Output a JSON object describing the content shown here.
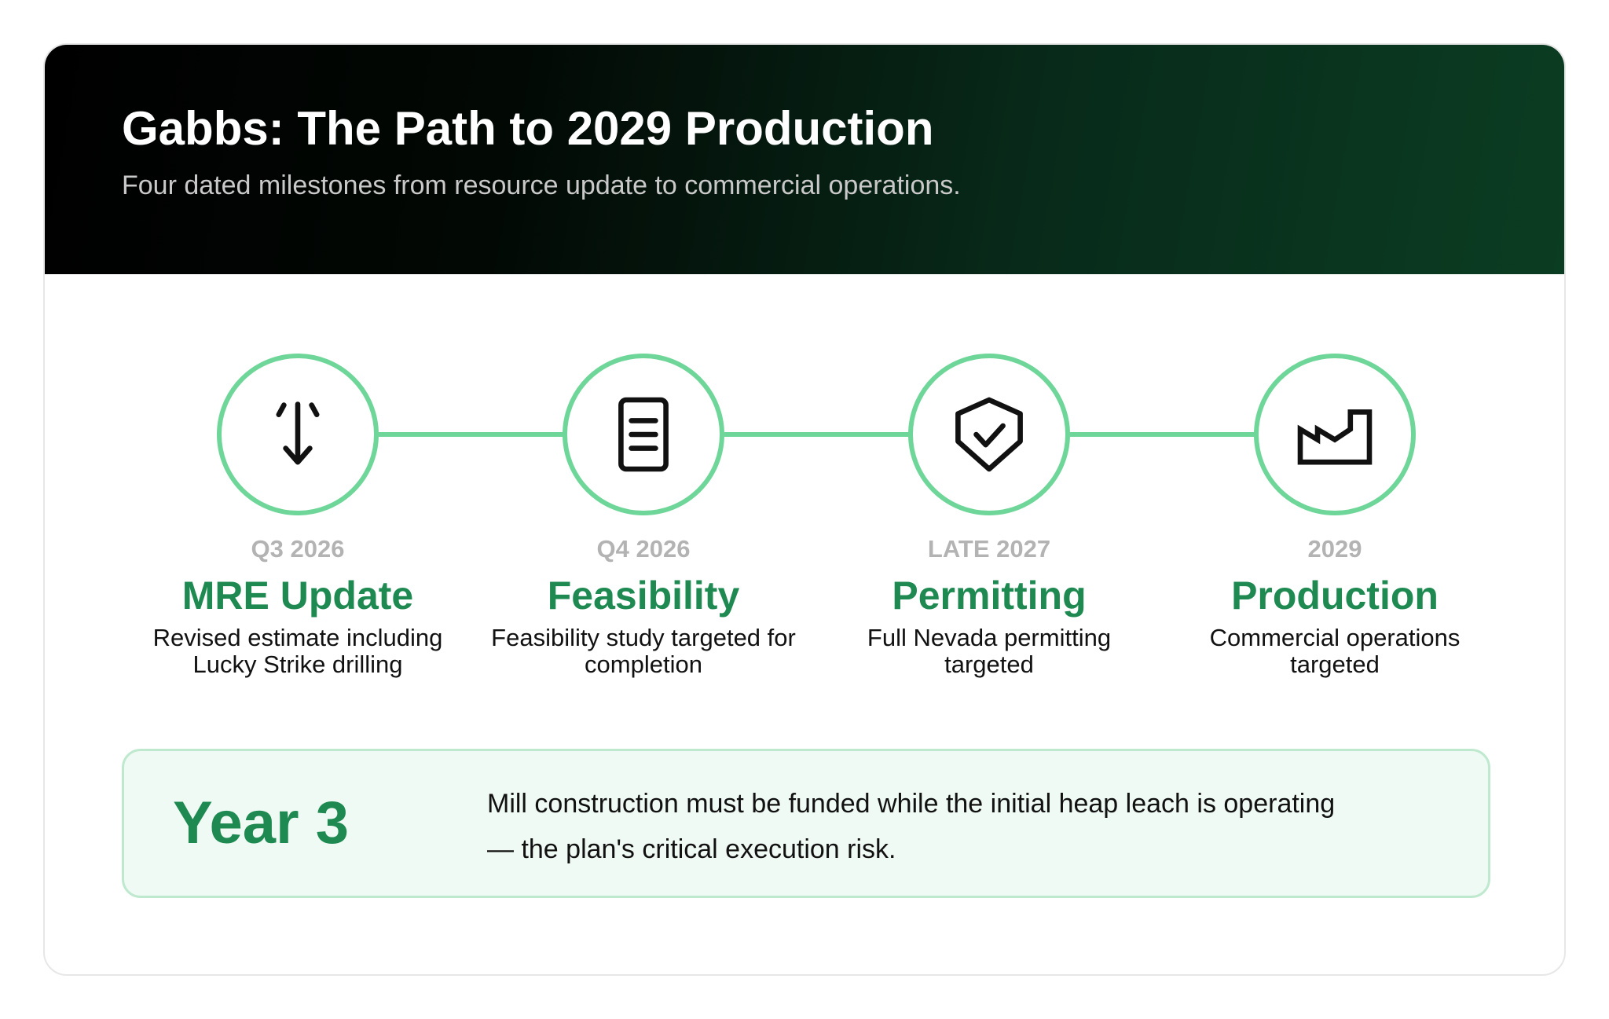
{
  "header": {
    "title": "Gabbs: The Path to 2029 Production",
    "subtitle": "Four dated milestones from resource update to commercial operations."
  },
  "milestones": [
    {
      "date": "Q3 2026",
      "title": "MRE Update",
      "description": "Revised estimate including Lucky Strike drilling",
      "icon": "drill-down-arrow-icon"
    },
    {
      "date": "Q4 2026",
      "title": "Feasibility",
      "description": "Feasibility study targeted for completion",
      "icon": "document-icon"
    },
    {
      "date": "LATE 2027",
      "title": "Permitting",
      "description": "Full Nevada permitting targeted",
      "icon": "shield-check-icon"
    },
    {
      "date": "2029",
      "title": "Production",
      "description": "Commercial operations targeted",
      "icon": "factory-icon"
    }
  ],
  "risk": {
    "label": "Year 3",
    "text": "Mill construction must be funded while the initial heap leach is operating — the plan's critical execution risk."
  },
  "colors": {
    "accent": "#1e8a52",
    "ring": "#6fd699",
    "date": "#b3b3b3",
    "risk_bg": "#f0faf4",
    "risk_border": "#bfe9cf"
  }
}
